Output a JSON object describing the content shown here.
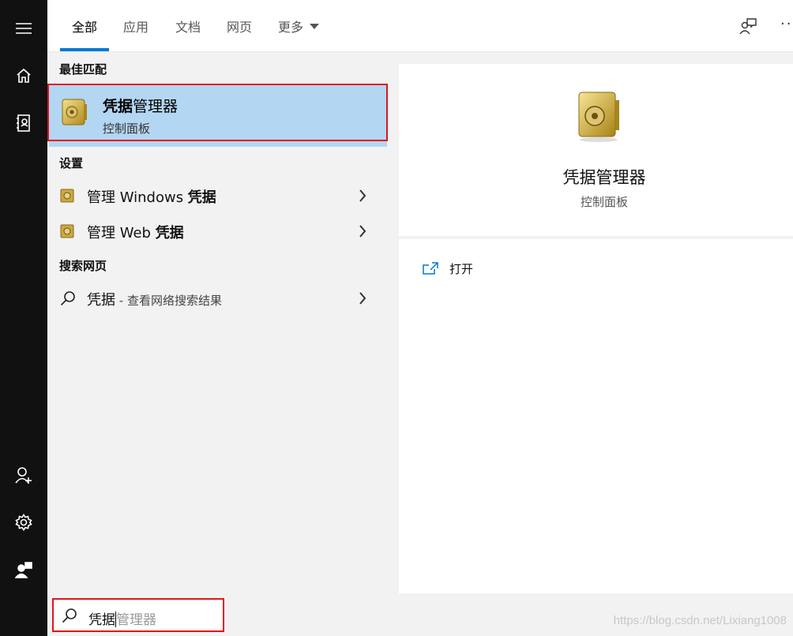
{
  "rail": {
    "top_items": [
      "menu-icon",
      "home-icon",
      "notebook-icon"
    ],
    "bottom_items": [
      "add-account-icon",
      "settings-icon",
      "feedback-icon"
    ]
  },
  "tabs": [
    {
      "label": "全部",
      "active": true
    },
    {
      "label": "应用",
      "active": false
    },
    {
      "label": "文档",
      "active": false
    },
    {
      "label": "网页",
      "active": false
    },
    {
      "label": "更多",
      "active": false
    }
  ],
  "header_icons": [
    "feedback-person-icon",
    "more-icon"
  ],
  "results": {
    "best_match_header": "最佳匹配",
    "best_match": {
      "title_bold": "凭据",
      "title_rest": "管理器",
      "subtitle": "控制面板"
    },
    "settings_header": "设置",
    "settings_items": [
      {
        "prefix": "管理 Windows ",
        "bold": "凭据"
      },
      {
        "prefix": "管理 Web ",
        "bold": "凭据"
      }
    ],
    "web_header": "搜索网页",
    "web_item": {
      "query": "凭据",
      "note": " - 查看网络搜索结果"
    }
  },
  "detail": {
    "title": "凭据管理器",
    "subtitle": "控制面板",
    "action_open": "打开"
  },
  "search": {
    "typed": "凭据",
    "suggestion": "管理器"
  },
  "watermark": "https://blog.csdn.net/Lixiang1008",
  "colors": {
    "accent": "#0078d7",
    "selection": "#b3d6f2",
    "highlight_box": "#e0141e",
    "rail": "#111111"
  }
}
